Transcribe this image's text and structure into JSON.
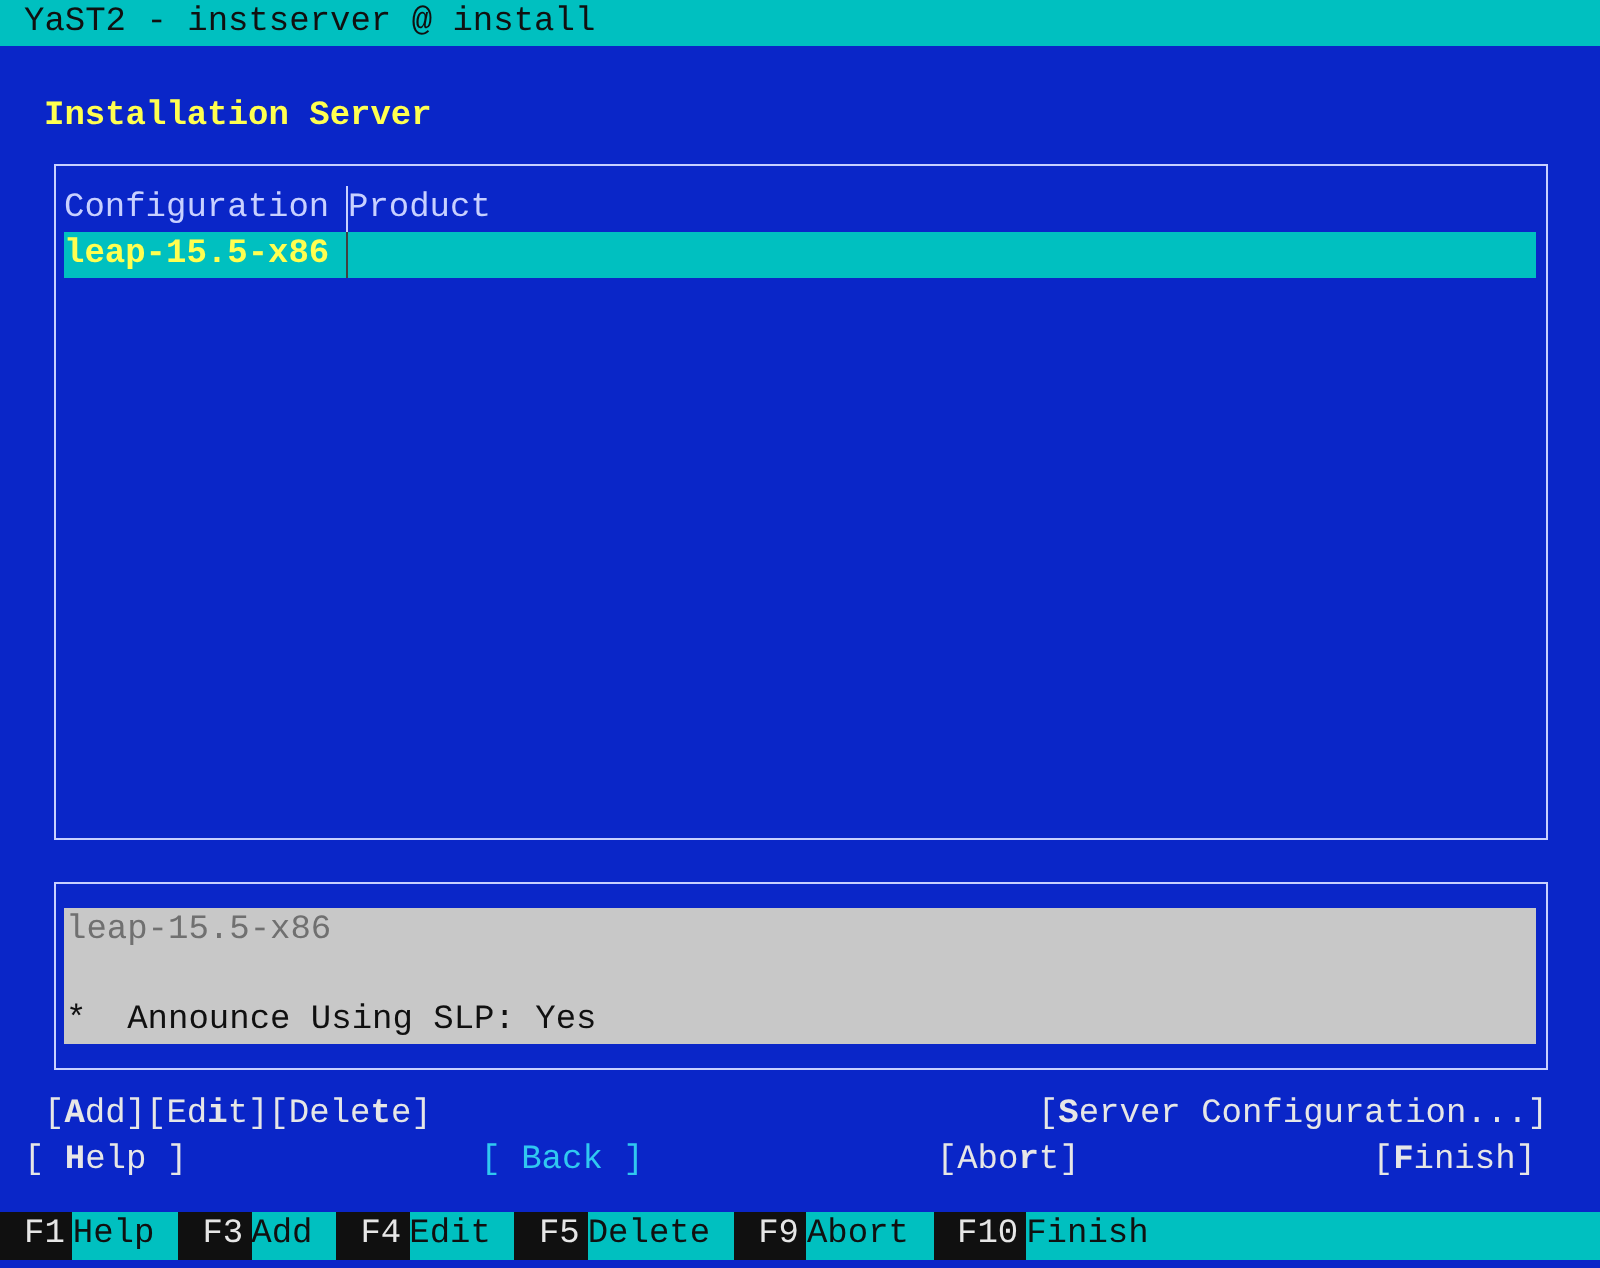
{
  "window": {
    "title": "YaST2 - instserver @ install"
  },
  "heading": "Installation Server",
  "table": {
    "columns": [
      "Configuration",
      "Product"
    ],
    "rows": [
      {
        "configuration": "leap-15.5-x86",
        "selected": true
      }
    ]
  },
  "details": {
    "title": "leap-15.5-x86",
    "lines": [
      "*  Announce Using SLP: Yes"
    ]
  },
  "action_buttons": [
    {
      "label": "[**A**dd]",
      "focused": false
    },
    {
      "label": "[Ed**i**t]",
      "focused": false
    },
    {
      "label": "[Dele**t**e]",
      "focused": false
    }
  ],
  "config_button": {
    "label": "[**S**erver Configuration...]",
    "focused": false
  },
  "nav_buttons": [
    {
      "label": "[ **H**elp ]",
      "focused": false
    },
    {
      "label": "[ Back ]",
      "focused": true
    },
    {
      "label": "[Abo**r**t]",
      "focused": false
    },
    {
      "label": "[**F**inish]",
      "focused": false
    }
  ],
  "function_keys": [
    {
      "key": "F1",
      "label": "Help"
    },
    {
      "key": "F3",
      "label": "Add"
    },
    {
      "key": "F4",
      "label": "Edit"
    },
    {
      "key": "F5",
      "label": "Delete"
    },
    {
      "key": "F9",
      "label": "Abort"
    },
    {
      "key": "F10",
      "label": "Finish"
    }
  ]
}
